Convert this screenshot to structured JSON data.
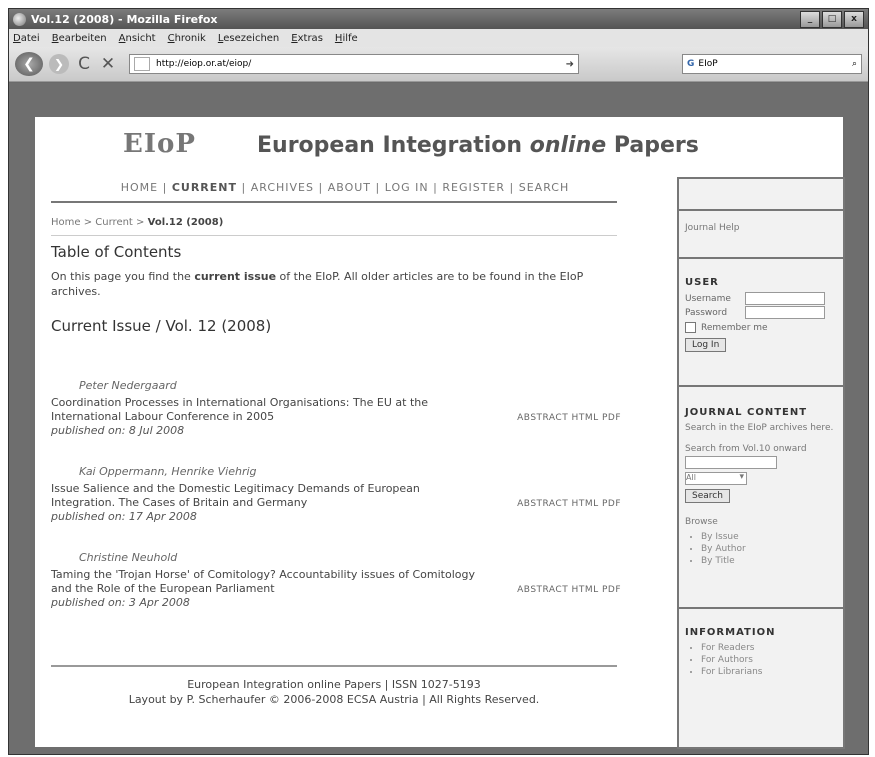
{
  "window": {
    "title": "Vol.12 (2008) - Mozilla Firefox",
    "min": "_",
    "max": "□",
    "close": "x"
  },
  "menu": [
    "Datei",
    "Bearbeiten",
    "Ansicht",
    "Chronik",
    "Lesezeichen",
    "Extras",
    "Hilfe"
  ],
  "nav": {
    "url": "http://eiop.or.at/eiop/",
    "search_value": "EIoP",
    "search_engine": "G",
    "back_glyph": "❮",
    "fwd_glyph": "❯",
    "reload_glyph": "C",
    "stop_glyph": "✕",
    "go_glyph": "➜",
    "search_glyph": "⌕"
  },
  "site": {
    "logo": "EIoP",
    "title_part1": "European Integration ",
    "title_part2": "online",
    "title_part3": " Papers",
    "nav": [
      "HOME",
      "CURRENT",
      "ARCHIVES",
      "ABOUT",
      "LOG IN",
      "REGISTER",
      "SEARCH"
    ],
    "nav_separator": "|",
    "breadcrumb": {
      "home": "Home",
      "current": "Current",
      "issue": "Vol.12 (2008)",
      "separator": ">"
    },
    "toc_title": "Table of Contents",
    "intro_pre": "On this page you find the ",
    "intro_bold": "current issue",
    "intro_mid": " of the EIoP. All older articles are to be found in the ",
    "intro_link": "EIoP archives",
    "intro_end": ".",
    "issue_title": "Current Issue / Vol. 12 (2008)",
    "articles": [
      {
        "authors": "Peter Nedergaard",
        "title": "Coordination Processes in International Organisations: The EU at the International Labour Conference in 2005",
        "published": "published on: 8 Jul 2008",
        "links": "ABSTRACT HTML PDF"
      },
      {
        "authors": "Kai Oppermann, Henrike Viehrig",
        "title": "Issue Salience and the Domestic Legitimacy Demands of European Integration. The Cases of Britain and Germany",
        "published": "published on: 17 Apr 2008",
        "links": "ABSTRACT HTML PDF"
      },
      {
        "authors": "Christine Neuhold",
        "title": "Taming the 'Trojan Horse' of Comitology? Accountability issues of Comitology and the Role of the European Parliament",
        "published": "published on: 3 Apr 2008",
        "links": "ABSTRACT HTML PDF"
      }
    ],
    "footer_line1": "European Integration online Papers | ISSN 1027-5193",
    "footer_line2": "Layout by P. Scherhaufer © 2006-2008 ECSA Austria | All Rights Reserved."
  },
  "sidebar": {
    "journal_help": "Journal Help",
    "user_heading": "USER",
    "username_label": "Username",
    "password_label": "Password",
    "remember_label": "Remember me",
    "login_button": "Log In",
    "journal_content_heading": "JOURNAL CONTENT",
    "search_archives_text": "Search in the EIoP archives here.",
    "search_from_text": "Search from Vol.10 onward",
    "scope_selected": "All",
    "search_button": "Search",
    "browse_label": "Browse",
    "browse_items": [
      "By Issue",
      "By Author",
      "By Title"
    ],
    "information_heading": "INFORMATION",
    "info_items": [
      "For Readers",
      "For Authors",
      "For Librarians"
    ]
  }
}
